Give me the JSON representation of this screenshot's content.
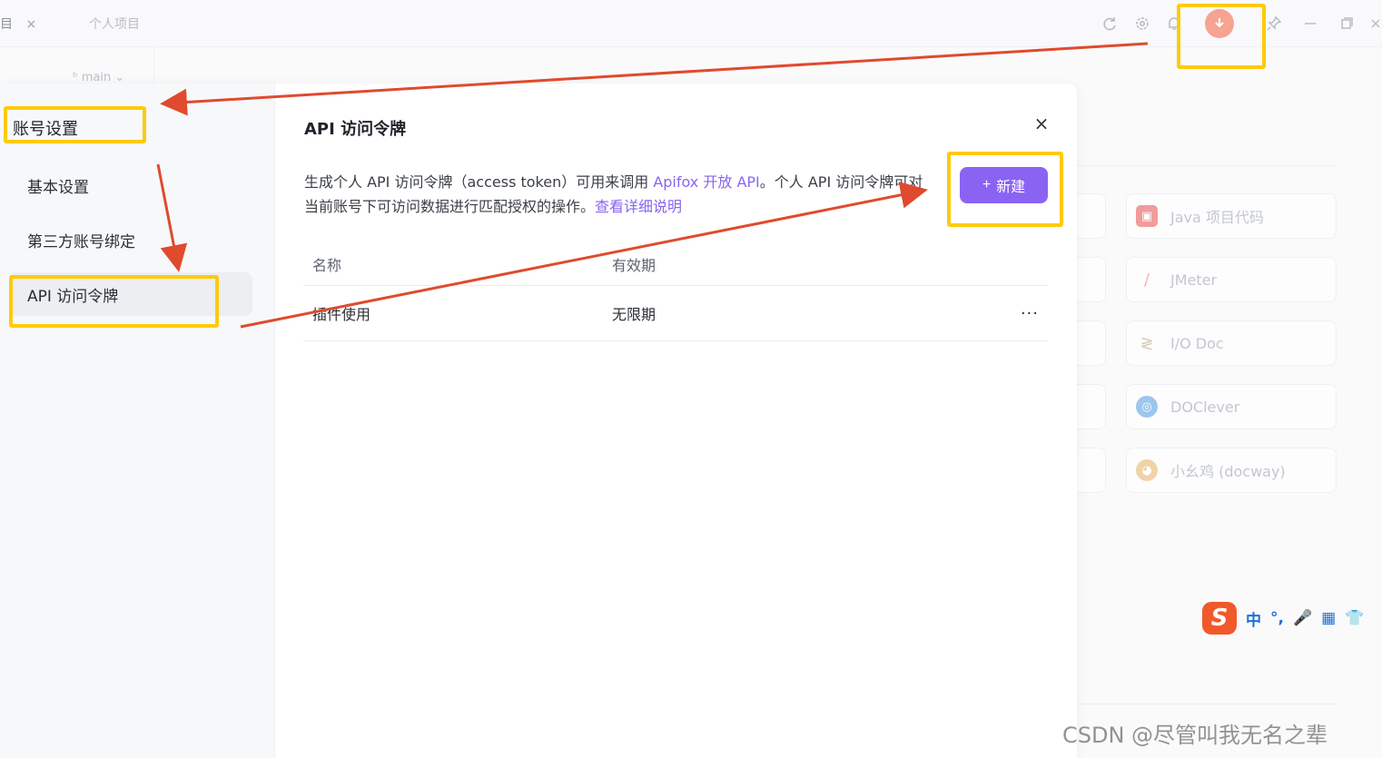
{
  "app": {
    "tab_fragment": "目",
    "tab_close": "×",
    "tab_name": "个人项目",
    "branch": "main",
    "avatar_icon": "avatar-icon"
  },
  "background_cards": [
    {
      "label": "Java 项目代码",
      "icon": "java-icon",
      "color": "#f29b9b"
    },
    {
      "label": "JMeter",
      "icon": "jmeter-icon",
      "color": "#f5b3b3"
    },
    {
      "label": "I/O Doc",
      "icon": "iodoc-icon",
      "color": "#d9cbb8"
    },
    {
      "label": "DOClever",
      "icon": "doclever-icon",
      "color": "#9dc6ee"
    },
    {
      "label": "小幺鸡 (docway)",
      "icon": "docway-icon",
      "color": "#f0d3a8"
    }
  ],
  "modal": {
    "sidebar_title": "账号设置",
    "sidebar_items": [
      {
        "label": "基本设置"
      },
      {
        "label": "第三方账号绑定"
      },
      {
        "label": "API 访问令牌"
      }
    ],
    "title": "API 访问令牌",
    "close": "×",
    "desc_1": "生成个人 API 访问令牌（access token）可用来调用 ",
    "desc_link_1": "Apifox 开放 API",
    "desc_2": "。个人 API 访问令牌可对当前账号下可访问数据进行匹配授权的操作。",
    "desc_link_2": "查看详细说明",
    "new_button": "新建",
    "new_button_icon": "+",
    "table": {
      "headers": [
        "名称",
        "有效期"
      ],
      "rows": [
        {
          "name": "插件使用",
          "validity": "无限期",
          "actions": "···"
        }
      ]
    }
  },
  "ime": {
    "logo": "S",
    "items": [
      "中",
      "°,",
      "🎤",
      "▦",
      "👕"
    ]
  },
  "watermark": "CSDN @尽管叫我无名之辈",
  "colors": {
    "accent": "#8a63f3",
    "link": "#8764f0",
    "highlight": "#ffca0a",
    "arrow": "#e04a2e"
  }
}
